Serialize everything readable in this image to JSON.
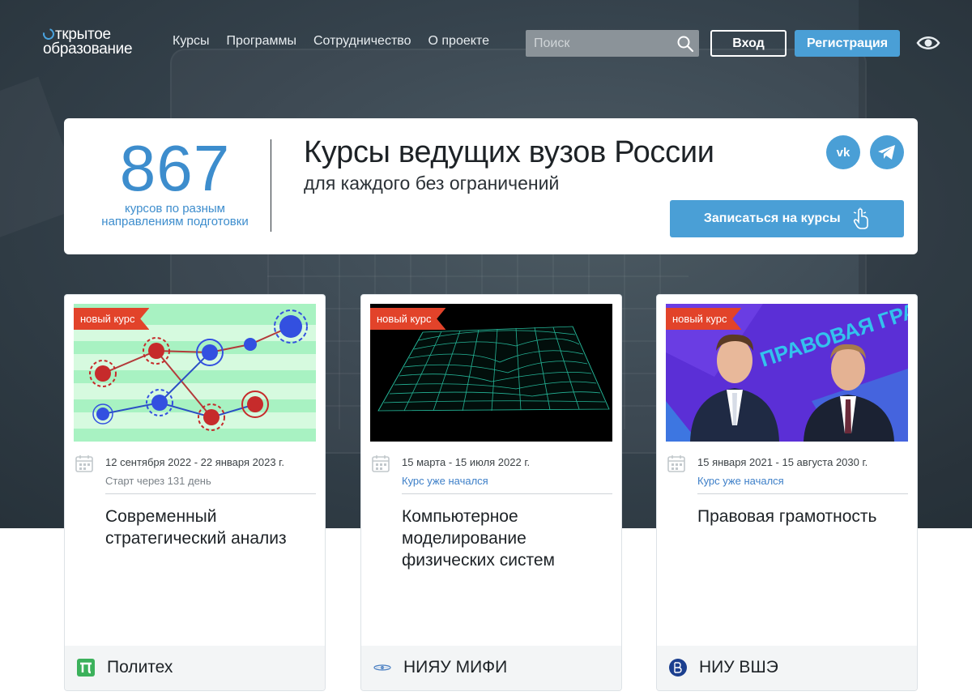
{
  "header": {
    "logo_line1": "ткрытое",
    "logo_line2": "образование",
    "nav": [
      "Курсы",
      "Программы",
      "Сотрудничество",
      "О проекте"
    ],
    "search_placeholder": "Поиск",
    "login_label": "Вход",
    "register_label": "Регистрация"
  },
  "banner": {
    "count": "867",
    "count_desc_line1": "курсов по разным",
    "count_desc_line2": "направлениям подготовки",
    "title": "Курсы ведущих вузов России",
    "subtitle": "для каждого без ограничений",
    "vk_label": "vk",
    "enroll_label": "Записаться на курсы"
  },
  "cards": [
    {
      "badge": "новый курс",
      "dates": "12 сентября 2022 - 22 января 2023 г.",
      "status": "Старт через 131 день",
      "title": "Современный стратегический анализ",
      "university": "Политех"
    },
    {
      "badge": "новый курс",
      "dates": "15 марта - 15 июля 2022 г.",
      "status": "Курс уже начался",
      "title": "Компьютерное моделирование физических систем",
      "university": "НИЯУ МИФИ"
    },
    {
      "badge": "новый курс",
      "dates": "15 января 2021 - 15 августа 2030 г.",
      "status": "Курс уже начался",
      "title": "Правовая грамотность",
      "image_text": "ПРАВОВАЯ ГРАМОТНОСТЬ",
      "university": "НИУ ВШЭ"
    }
  ],
  "colors": {
    "accent": "#4a9fd6",
    "badge": "#e2432a",
    "hero_bg": "#36434d",
    "status_link": "#3d7fc8"
  }
}
